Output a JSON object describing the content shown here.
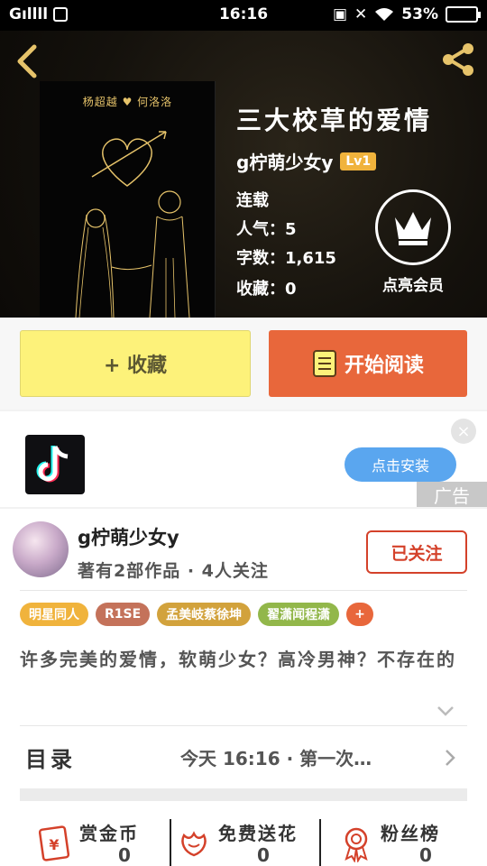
{
  "status_bar": {
    "carrier": "Gıllll",
    "time": "16:16",
    "battery": "53%"
  },
  "book": {
    "cover_names": "杨超越 ♥ 何洛洛",
    "title": "三大校草的爱情",
    "author": "g柠萌少女y",
    "level": "Lv1",
    "status": "连载",
    "popularity": "人气：5",
    "word_count": "字数：1,615",
    "favorites": "收藏：0",
    "vip_label": "点亮会员"
  },
  "actions": {
    "collect_label": "+ 收藏",
    "read_label": "开始阅读"
  },
  "ad": {
    "install_label": "点击安装",
    "close": "×",
    "ad_tag": "广告"
  },
  "author_card": {
    "name": "g柠萌少女y",
    "works": "著有2部作品 · 4人关注",
    "follow_label": "已关注",
    "tags": [
      {
        "label": "明星同人",
        "color": "#f0b33c"
      },
      {
        "label": "R1SE",
        "color": "#c4725a"
      },
      {
        "label": "孟美岐蔡徐坤",
        "color": "#d2a23c"
      },
      {
        "label": "翟潇闻程潇",
        "color": "#92b74a"
      },
      {
        "label": "+",
        "color": "#e8673b"
      }
    ],
    "description": "许多完美的爱情，软萌少女？高冷男神？不存在的"
  },
  "toc": {
    "label": "目录",
    "update": "今天 16:16 · 第一次…"
  },
  "stats": [
    {
      "label": "赏金币",
      "value": "0",
      "icon": "red-envelope-icon"
    },
    {
      "label": "免费送花",
      "value": "0",
      "icon": "flower-icon"
    },
    {
      "label": "粉丝榜",
      "value": "0",
      "icon": "medal-icon"
    }
  ],
  "colors": {
    "accent_orange": "#e8673b",
    "collect_yellow": "#fdf27a",
    "icon_gold": "#e6c36a",
    "follow_red": "#d4412a",
    "stat_icon_red": "#d4412a"
  }
}
